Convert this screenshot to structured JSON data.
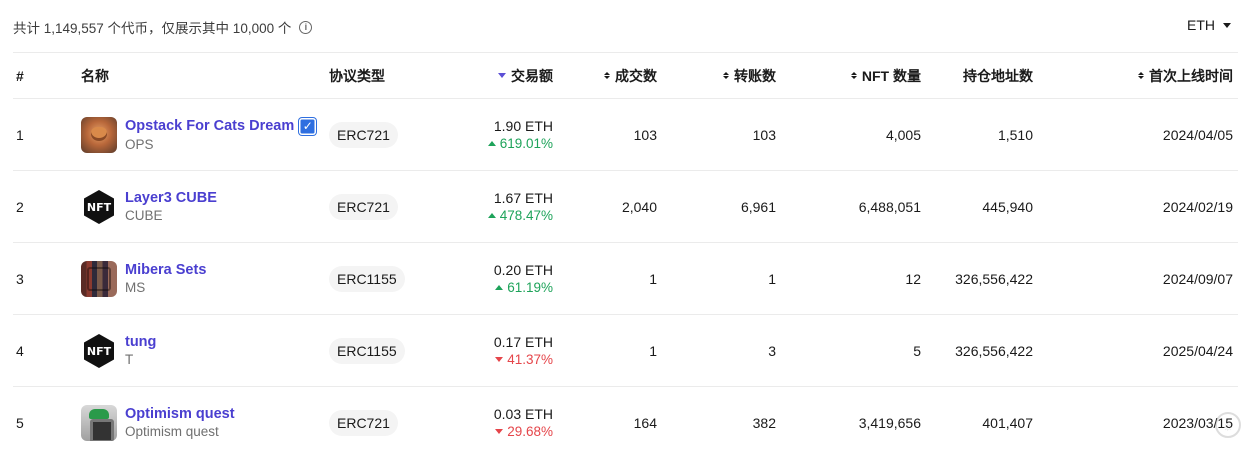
{
  "summary": {
    "text": "共计 1,149,557 个代币，仅展示其中 10,000 个",
    "info_icon": "info-icon"
  },
  "currency": {
    "selected": "ETH",
    "icon": "caret-down-icon"
  },
  "table": {
    "headers": {
      "index": "#",
      "name": "名称",
      "protocol": "协议类型",
      "volume": "交易额",
      "trades": "成交数",
      "transfers": "转账数",
      "nft_count": "NFT 数量",
      "holders": "持仓地址数",
      "first_listed": "首次上线时间"
    },
    "rows": [
      {
        "index": "1",
        "name": "Opstack For Cats Dream",
        "symbol": "OPS",
        "verified": true,
        "avatar_icon": "cat-collection-icon",
        "protocol": "ERC721",
        "volume": "1.90 ETH",
        "change": "619.01%",
        "change_dir": "up",
        "trades": "103",
        "transfers": "103",
        "nft_count": "4,005",
        "holders": "1,510",
        "first_listed": "2024/04/05"
      },
      {
        "index": "2",
        "name": "Layer3 CUBE",
        "symbol": "CUBE",
        "verified": false,
        "avatar_icon": "nft-hexagon-icon",
        "protocol": "ERC721",
        "volume": "1.67 ETH",
        "change": "478.47%",
        "change_dir": "up",
        "trades": "2,040",
        "transfers": "6,961",
        "nft_count": "6,488,051",
        "holders": "445,940",
        "first_listed": "2024/02/19"
      },
      {
        "index": "3",
        "name": "Mibera Sets",
        "symbol": "MS",
        "verified": false,
        "avatar_icon": "bookshelf-icon",
        "protocol": "ERC1155",
        "volume": "0.20 ETH",
        "change": "61.19%",
        "change_dir": "up",
        "trades": "1",
        "transfers": "1",
        "nft_count": "12",
        "holders": "326,556,422",
        "first_listed": "2024/09/07"
      },
      {
        "index": "4",
        "name": "tung",
        "symbol": "T",
        "verified": false,
        "avatar_icon": "nft-hexagon-icon",
        "protocol": "ERC1155",
        "volume": "0.17 ETH",
        "change": "41.37%",
        "change_dir": "down",
        "trades": "1",
        "transfers": "3",
        "nft_count": "5",
        "holders": "326,556,422",
        "first_listed": "2025/04/24"
      },
      {
        "index": "5",
        "name": "Optimism quest",
        "symbol": "Optimism quest",
        "verified": false,
        "avatar_icon": "optimism-quest-icon",
        "protocol": "ERC721",
        "volume": "0.03 ETH",
        "change": "29.68%",
        "change_dir": "down",
        "trades": "164",
        "transfers": "382",
        "nft_count": "3,419,656",
        "holders": "401,407",
        "first_listed": "2023/03/15"
      }
    ]
  },
  "colors": {
    "link": "#4a3fd0",
    "up": "#1ea35a",
    "down": "#e5454a",
    "active_sort": "#5c4fd6"
  }
}
